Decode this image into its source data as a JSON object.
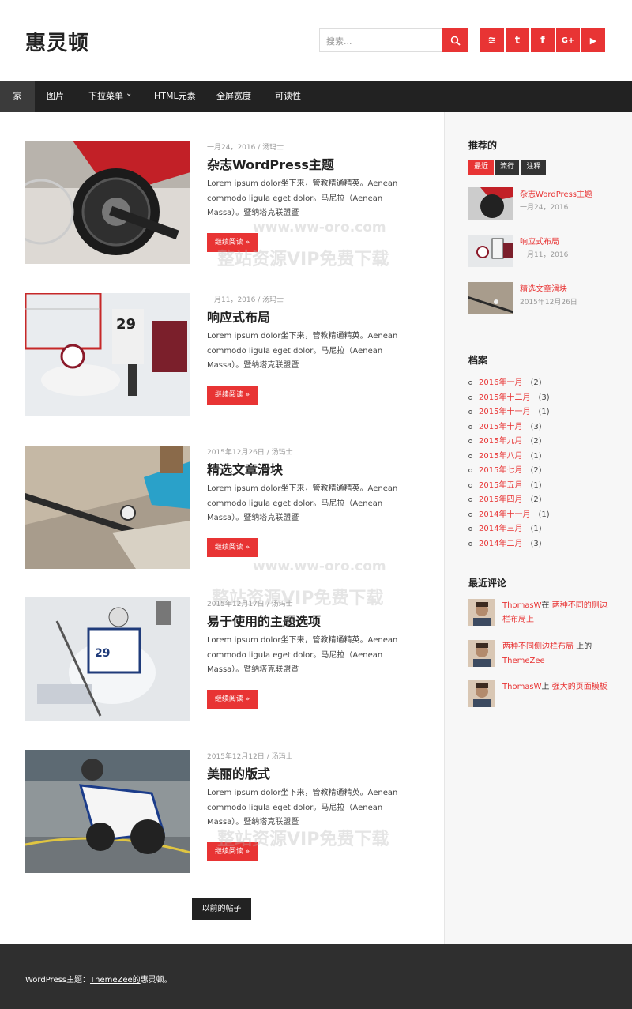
{
  "site": {
    "title": "惠灵顿"
  },
  "search": {
    "placeholder": "搜索..."
  },
  "social": [
    {
      "icon": "rss-icon",
      "glyph": "≋"
    },
    {
      "icon": "twitter-icon",
      "glyph": "t"
    },
    {
      "icon": "facebook-icon",
      "glyph": "f"
    },
    {
      "icon": "google-plus-icon",
      "glyph": "G+"
    },
    {
      "icon": "youtube-icon",
      "glyph": "▶"
    }
  ],
  "nav": {
    "items": [
      {
        "label": "家"
      },
      {
        "label": "图片"
      },
      {
        "label": "下拉菜单"
      },
      {
        "label": "HTML元素"
      },
      {
        "label": "全屏宽度"
      },
      {
        "label": "可读性"
      }
    ],
    "dropdown_glyph": "⌄"
  },
  "posts": [
    {
      "date": "一月24，2016",
      "author": "汤玛士",
      "title": "杂志WordPress主题",
      "excerpt": "Lorem ipsum dolor坐下来，管教精通精英。Aenean commodo ligula eget dolor。马尼拉（Aenean Massa）。暨纳塔克联盟暨",
      "read_more": "继续阅读 »"
    },
    {
      "date": "一月11，2016",
      "author": "汤玛士",
      "title": "响应式布局",
      "excerpt": "Lorem ipsum dolor坐下来，管教精通精英。Aenean commodo ligula eget dolor。马尼拉（Aenean Massa）。暨纳塔克联盟暨",
      "read_more": "继续阅读 »"
    },
    {
      "date": "2015年12月26日",
      "author": "汤玛士",
      "title": "精选文章滑块",
      "excerpt": "Lorem ipsum dolor坐下来，管教精通精英。Aenean commodo ligula eget dolor。马尼拉（Aenean Massa）。暨纳塔克联盟暨",
      "read_more": "继续阅读 »"
    },
    {
      "date": "2015年12月17日",
      "author": "汤玛士",
      "title": "易于使用的主题选项",
      "excerpt": "Lorem ipsum dolor坐下来，管教精通精英。Aenean commodo ligula eget dolor。马尼拉（Aenean Massa）。暨纳塔克联盟暨",
      "read_more": "继续阅读 »"
    },
    {
      "date": "2015年12月12日",
      "author": "汤玛士",
      "title": "美丽的版式",
      "excerpt": "Lorem ipsum dolor坐下来，管教精通精英。Aenean commodo ligula eget dolor。马尼拉（Aenean Massa）。暨纳塔克联盟暨",
      "read_more": "继续阅读 »"
    }
  ],
  "meta_sep": "/",
  "pagination": {
    "prev_label": "以前的帖子"
  },
  "sidebar": {
    "recommended": {
      "title": "推荐的",
      "tabs": [
        "最近",
        "流行",
        "注释"
      ],
      "items": [
        {
          "title": "杂志WordPress主题",
          "date": "一月24，2016"
        },
        {
          "title": "响应式布局",
          "date": "一月11，2016"
        },
        {
          "title": "精选文章滑块",
          "date": "2015年12月26日"
        }
      ]
    },
    "archive": {
      "title": "档案",
      "items": [
        {
          "label": "2016年一月",
          "count": "(2)"
        },
        {
          "label": "2015年十二月",
          "count": "(3)"
        },
        {
          "label": "2015年十一月",
          "count": "(1)"
        },
        {
          "label": "2015年十月",
          "count": "(3)"
        },
        {
          "label": "2015年九月",
          "count": "(2)"
        },
        {
          "label": "2015年八月",
          "count": "(1)"
        },
        {
          "label": "2015年七月",
          "count": "(2)"
        },
        {
          "label": "2015年五月",
          "count": "(1)"
        },
        {
          "label": "2015年四月",
          "count": "(2)"
        },
        {
          "label": "2014年十一月",
          "count": "(1)"
        },
        {
          "label": "2014年三月",
          "count": "(1)"
        },
        {
          "label": "2014年二月",
          "count": "(3)"
        }
      ]
    },
    "comments": {
      "title": "最近评论",
      "items": [
        {
          "author": "ThomasW",
          "mid": "在",
          "post": "两种不同的侧边栏布局上",
          "tail": ""
        },
        {
          "author": "两种不同侧边栏布局",
          "mid": "上的",
          "post": "ThemeZee",
          "tail": ""
        },
        {
          "author": "ThomasW",
          "mid": "上 ",
          "post": "强大的页面模板",
          "tail": ""
        }
      ]
    }
  },
  "footer": {
    "prefix": "WordPress主题：",
    "link": "ThemeZee的",
    "suffix": "惠灵顿。"
  },
  "watermarks": {
    "url": "www.ww-oro.com",
    "cn": "整站资源VIP免费下载"
  },
  "colors": {
    "accent": "#e83434",
    "dark": "#222222",
    "footer": "#2f2f2f"
  }
}
